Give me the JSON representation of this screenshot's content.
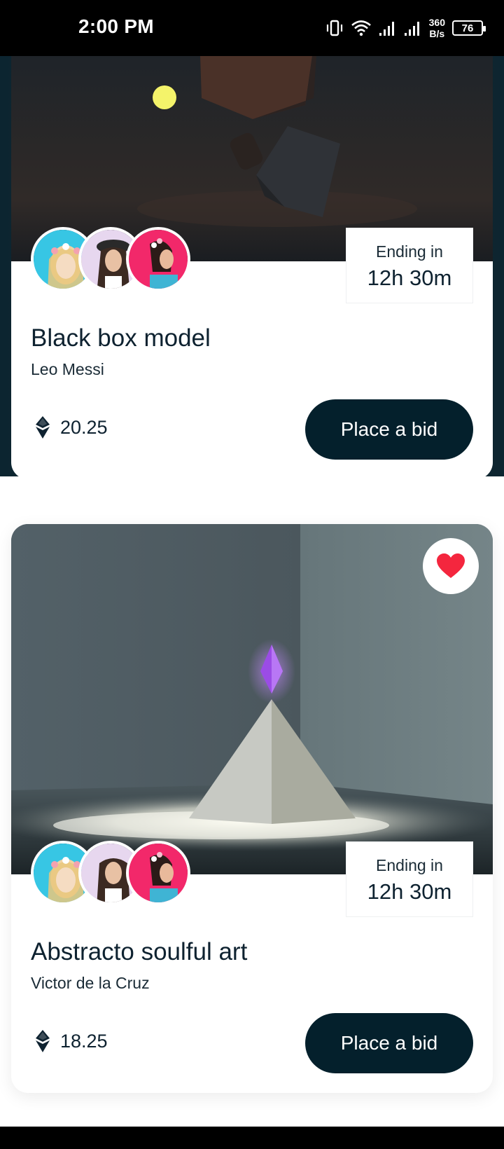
{
  "status_bar": {
    "time": "2:00 PM",
    "net_speed_value": "360",
    "net_speed_unit": "B/s",
    "battery": "76"
  },
  "cards": [
    {
      "title": "Black box model",
      "artist": "Leo Messi",
      "ending_label": "Ending in",
      "ending_time": "12h 30m",
      "price": "20.25",
      "bid_label": "Place a bid",
      "favorite": false
    },
    {
      "title": "Abstracto soulful art",
      "artist": "Victor de la Cruz",
      "ending_label": "Ending in",
      "ending_time": "12h 30m",
      "price": "18.25",
      "bid_label": "Place a bid",
      "favorite": true
    }
  ],
  "icons": {
    "currency": "ethereum-icon",
    "favorite": "heart-icon"
  },
  "colors": {
    "primary_button": "#04202c",
    "heart": "#f4263e",
    "text": "#0e2230"
  }
}
